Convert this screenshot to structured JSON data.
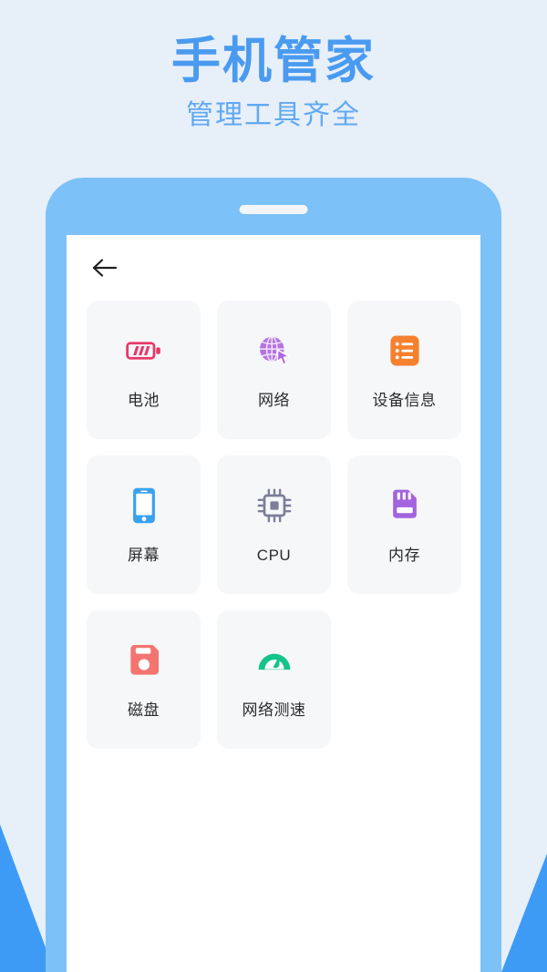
{
  "theme": {
    "background": "#e7eff9",
    "accent_blue": "#4a9bf0",
    "subtitle_blue": "#60a9f2",
    "phone_body": "#7cc1f7",
    "corner_triangle": "#3d9bf5",
    "card_background": "#f6f7f9",
    "label_color": "#2b2b2b"
  },
  "headline": {
    "title": "手机管家",
    "subtitle": "管理工具齐全"
  },
  "phone": {
    "speaker_name": "phone-speaker-bar"
  },
  "app_header": {
    "back_icon": "arrow-left-icon"
  },
  "tools": [
    {
      "label": "电池",
      "icon": "battery-icon",
      "color": "#e8386a"
    },
    {
      "label": "网络",
      "icon": "globe-cursor-icon",
      "color": "#b067e0"
    },
    {
      "label": "设备信息",
      "icon": "list-icon",
      "color": "#f5812f"
    },
    {
      "label": "屏幕",
      "icon": "phone-icon",
      "color": "#3ba1ef"
    },
    {
      "label": "CPU",
      "icon": "cpu-chip-icon",
      "color": "#7b7f99"
    },
    {
      "label": "内存",
      "icon": "sd-card-icon",
      "color": "#a364dd"
    },
    {
      "label": "磁盘",
      "icon": "floppy-disk-icon",
      "color": "#f4746f"
    },
    {
      "label": "网络测速",
      "icon": "speedometer-icon",
      "color": "#14c48a"
    }
  ]
}
